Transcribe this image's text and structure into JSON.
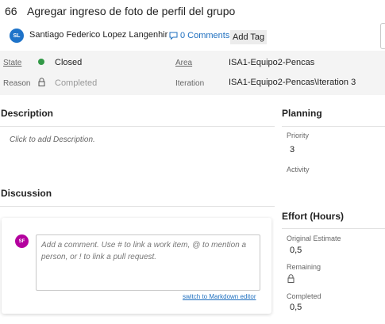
{
  "work_item": {
    "id": "66",
    "title": "Agregar ingreso de foto de perfil del grupo",
    "owner_initials": "SL",
    "owner_name": "Santiago Federico Lopez Langenhir",
    "comments_label": "0 Comments",
    "add_tag_label": "Add Tag"
  },
  "fields": {
    "state_label": "State",
    "state_value": "Closed",
    "reason_label": "Reason",
    "reason_value": "Completed",
    "area_label": "Area",
    "area_value": "ISA1-Equipo2-Pencas",
    "iteration_label": "Iteration",
    "iteration_value": "ISA1-Equipo2-Pencas\\Iteration 3"
  },
  "description": {
    "heading": "Description",
    "placeholder": "Click to add Description."
  },
  "discussion": {
    "heading": "Discussion",
    "avatar_initials": "SF",
    "comment_placeholder": "Add a comment. Use # to link a work item, @ to mention a person, or ! to link a pull request.",
    "markdown_link": "switch to Markdown editor"
  },
  "planning": {
    "heading": "Planning",
    "priority_label": "Priority",
    "priority_value": "3",
    "activity_label": "Activity"
  },
  "effort": {
    "heading": "Effort (Hours)",
    "original_estimate_label": "Original Estimate",
    "original_estimate_value": "0,5",
    "remaining_label": "Remaining",
    "completed_label": "Completed",
    "completed_value": "0,5"
  },
  "colors": {
    "state_closed": "#339947",
    "link_blue": "#1e6fbf",
    "avatar_sl": "#1e73c9",
    "avatar_sf": "#b4009e"
  },
  "icons": [
    "comment-icon",
    "lock-icon",
    "state-dot-icon"
  ]
}
